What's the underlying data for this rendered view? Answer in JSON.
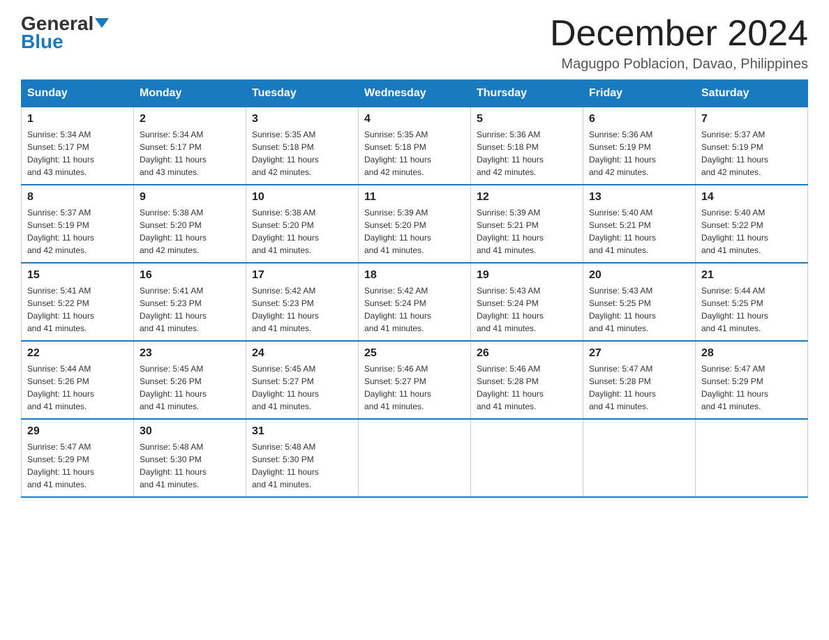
{
  "header": {
    "logo": {
      "top": "General",
      "bottom": "Blue"
    },
    "title": "December 2024",
    "subtitle": "Magugpo Poblacion, Davao, Philippines"
  },
  "days_of_week": [
    "Sunday",
    "Monday",
    "Tuesday",
    "Wednesday",
    "Thursday",
    "Friday",
    "Saturday"
  ],
  "weeks": [
    [
      {
        "day": "1",
        "sunrise": "5:34 AM",
        "sunset": "5:17 PM",
        "daylight": "11 hours and 43 minutes."
      },
      {
        "day": "2",
        "sunrise": "5:34 AM",
        "sunset": "5:17 PM",
        "daylight": "11 hours and 43 minutes."
      },
      {
        "day": "3",
        "sunrise": "5:35 AM",
        "sunset": "5:18 PM",
        "daylight": "11 hours and 42 minutes."
      },
      {
        "day": "4",
        "sunrise": "5:35 AM",
        "sunset": "5:18 PM",
        "daylight": "11 hours and 42 minutes."
      },
      {
        "day": "5",
        "sunrise": "5:36 AM",
        "sunset": "5:18 PM",
        "daylight": "11 hours and 42 minutes."
      },
      {
        "day": "6",
        "sunrise": "5:36 AM",
        "sunset": "5:19 PM",
        "daylight": "11 hours and 42 minutes."
      },
      {
        "day": "7",
        "sunrise": "5:37 AM",
        "sunset": "5:19 PM",
        "daylight": "11 hours and 42 minutes."
      }
    ],
    [
      {
        "day": "8",
        "sunrise": "5:37 AM",
        "sunset": "5:19 PM",
        "daylight": "11 hours and 42 minutes."
      },
      {
        "day": "9",
        "sunrise": "5:38 AM",
        "sunset": "5:20 PM",
        "daylight": "11 hours and 42 minutes."
      },
      {
        "day": "10",
        "sunrise": "5:38 AM",
        "sunset": "5:20 PM",
        "daylight": "11 hours and 41 minutes."
      },
      {
        "day": "11",
        "sunrise": "5:39 AM",
        "sunset": "5:20 PM",
        "daylight": "11 hours and 41 minutes."
      },
      {
        "day": "12",
        "sunrise": "5:39 AM",
        "sunset": "5:21 PM",
        "daylight": "11 hours and 41 minutes."
      },
      {
        "day": "13",
        "sunrise": "5:40 AM",
        "sunset": "5:21 PM",
        "daylight": "11 hours and 41 minutes."
      },
      {
        "day": "14",
        "sunrise": "5:40 AM",
        "sunset": "5:22 PM",
        "daylight": "11 hours and 41 minutes."
      }
    ],
    [
      {
        "day": "15",
        "sunrise": "5:41 AM",
        "sunset": "5:22 PM",
        "daylight": "11 hours and 41 minutes."
      },
      {
        "day": "16",
        "sunrise": "5:41 AM",
        "sunset": "5:23 PM",
        "daylight": "11 hours and 41 minutes."
      },
      {
        "day": "17",
        "sunrise": "5:42 AM",
        "sunset": "5:23 PM",
        "daylight": "11 hours and 41 minutes."
      },
      {
        "day": "18",
        "sunrise": "5:42 AM",
        "sunset": "5:24 PM",
        "daylight": "11 hours and 41 minutes."
      },
      {
        "day": "19",
        "sunrise": "5:43 AM",
        "sunset": "5:24 PM",
        "daylight": "11 hours and 41 minutes."
      },
      {
        "day": "20",
        "sunrise": "5:43 AM",
        "sunset": "5:25 PM",
        "daylight": "11 hours and 41 minutes."
      },
      {
        "day": "21",
        "sunrise": "5:44 AM",
        "sunset": "5:25 PM",
        "daylight": "11 hours and 41 minutes."
      }
    ],
    [
      {
        "day": "22",
        "sunrise": "5:44 AM",
        "sunset": "5:26 PM",
        "daylight": "11 hours and 41 minutes."
      },
      {
        "day": "23",
        "sunrise": "5:45 AM",
        "sunset": "5:26 PM",
        "daylight": "11 hours and 41 minutes."
      },
      {
        "day": "24",
        "sunrise": "5:45 AM",
        "sunset": "5:27 PM",
        "daylight": "11 hours and 41 minutes."
      },
      {
        "day": "25",
        "sunrise": "5:46 AM",
        "sunset": "5:27 PM",
        "daylight": "11 hours and 41 minutes."
      },
      {
        "day": "26",
        "sunrise": "5:46 AM",
        "sunset": "5:28 PM",
        "daylight": "11 hours and 41 minutes."
      },
      {
        "day": "27",
        "sunrise": "5:47 AM",
        "sunset": "5:28 PM",
        "daylight": "11 hours and 41 minutes."
      },
      {
        "day": "28",
        "sunrise": "5:47 AM",
        "sunset": "5:29 PM",
        "daylight": "11 hours and 41 minutes."
      }
    ],
    [
      {
        "day": "29",
        "sunrise": "5:47 AM",
        "sunset": "5:29 PM",
        "daylight": "11 hours and 41 minutes."
      },
      {
        "day": "30",
        "sunrise": "5:48 AM",
        "sunset": "5:30 PM",
        "daylight": "11 hours and 41 minutes."
      },
      {
        "day": "31",
        "sunrise": "5:48 AM",
        "sunset": "5:30 PM",
        "daylight": "11 hours and 41 minutes."
      },
      null,
      null,
      null,
      null
    ]
  ],
  "labels": {
    "sunrise": "Sunrise:",
    "sunset": "Sunset:",
    "daylight": "Daylight:"
  }
}
